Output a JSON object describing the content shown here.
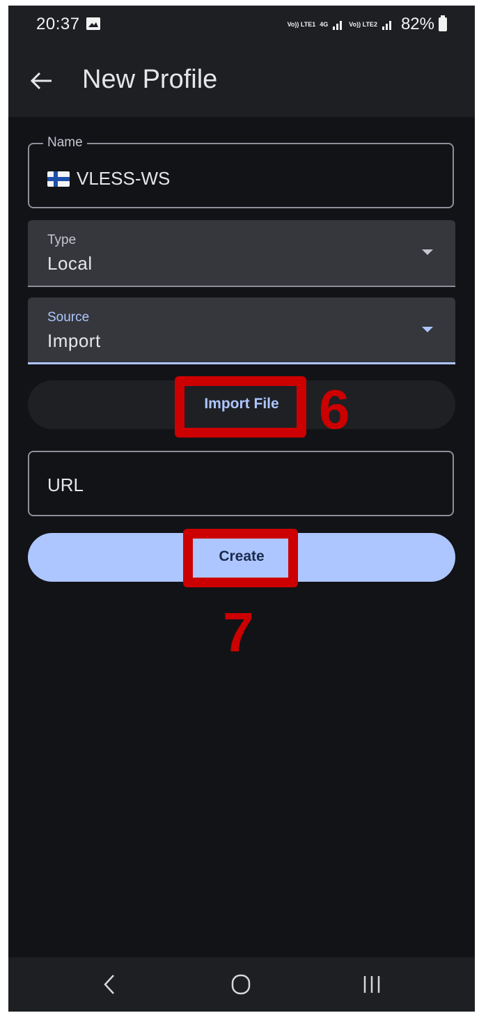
{
  "status_bar": {
    "time": "20:37",
    "network_1": "Vo)) LTE1",
    "network_type": "4G",
    "network_2": "Vo)) LTE2",
    "battery": "82%",
    "image_icon": "image-icon",
    "signal_icon": "signal-icon",
    "battery_icon": "battery-icon"
  },
  "app_bar": {
    "title": "New Profile",
    "back_icon": "arrow-left-icon"
  },
  "form": {
    "name_label": "Name",
    "name_value": "VLESS-WS",
    "name_flag": "finland-flag-icon",
    "type_label": "Type",
    "type_value": "Local",
    "source_label": "Source",
    "source_value": "Import",
    "import_button": "Import File",
    "url_placeholder": "URL",
    "create_button": "Create"
  },
  "annotations": {
    "step_import": "6",
    "step_create": "7"
  },
  "colors": {
    "background": "#121317",
    "surface": "#1d1f22",
    "field_fill": "#35373c",
    "accent": "#aec6ff",
    "annotation": "#cc0000"
  },
  "nav_bar": {
    "back_icon": "nav-back-icon",
    "home_icon": "nav-home-icon",
    "recents_icon": "nav-recents-icon"
  }
}
